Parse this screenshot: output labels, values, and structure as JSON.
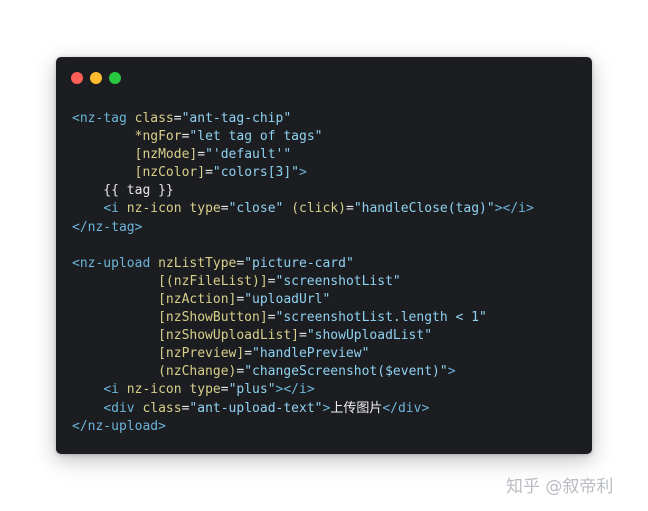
{
  "window": {
    "controls": [
      {
        "name": "close",
        "color": "#ff5f57"
      },
      {
        "name": "minimize",
        "color": "#febc2e"
      },
      {
        "name": "maximize",
        "color": "#28c840"
      }
    ]
  },
  "code_lines": [
    [
      {
        "t": "tag",
        "v": "<nz-tag "
      },
      {
        "t": "attr",
        "v": "class"
      },
      {
        "t": "punc",
        "v": "="
      },
      {
        "t": "str",
        "v": "\"ant-tag-chip\""
      }
    ],
    [
      {
        "t": "plain",
        "v": "        "
      },
      {
        "t": "attr",
        "v": "*ngFor"
      },
      {
        "t": "punc",
        "v": "="
      },
      {
        "t": "str",
        "v": "\"let tag of tags\""
      }
    ],
    [
      {
        "t": "plain",
        "v": "        "
      },
      {
        "t": "attr",
        "v": "[nzMode]"
      },
      {
        "t": "punc",
        "v": "="
      },
      {
        "t": "str",
        "v": "\"'default'\""
      }
    ],
    [
      {
        "t": "plain",
        "v": "        "
      },
      {
        "t": "attr",
        "v": "[nzColor]"
      },
      {
        "t": "punc",
        "v": "="
      },
      {
        "t": "str",
        "v": "\"colors[3]\""
      },
      {
        "t": "tag",
        "v": ">"
      }
    ],
    [
      {
        "t": "plain",
        "v": "    {{ tag }}"
      }
    ],
    [
      {
        "t": "plain",
        "v": "    "
      },
      {
        "t": "tag",
        "v": "<i "
      },
      {
        "t": "attr",
        "v": "nz-icon "
      },
      {
        "t": "attr",
        "v": "type"
      },
      {
        "t": "punc",
        "v": "="
      },
      {
        "t": "str",
        "v": "\"close\""
      },
      {
        "t": "plain",
        "v": " "
      },
      {
        "t": "attr",
        "v": "(click)"
      },
      {
        "t": "punc",
        "v": "="
      },
      {
        "t": "str",
        "v": "\"handleClose(tag)\""
      },
      {
        "t": "tag",
        "v": "></i>"
      }
    ],
    [
      {
        "t": "tag",
        "v": "</nz-tag>"
      }
    ],
    [
      {
        "t": "plain",
        "v": ""
      }
    ],
    [
      {
        "t": "tag",
        "v": "<nz-upload "
      },
      {
        "t": "attr",
        "v": "nzListType"
      },
      {
        "t": "punc",
        "v": "="
      },
      {
        "t": "str",
        "v": "\"picture-card\""
      }
    ],
    [
      {
        "t": "plain",
        "v": "           "
      },
      {
        "t": "attr",
        "v": "[(nzFileList)]"
      },
      {
        "t": "punc",
        "v": "="
      },
      {
        "t": "str",
        "v": "\"screenshotList\""
      }
    ],
    [
      {
        "t": "plain",
        "v": "           "
      },
      {
        "t": "attr",
        "v": "[nzAction]"
      },
      {
        "t": "punc",
        "v": "="
      },
      {
        "t": "str",
        "v": "\"uploadUrl\""
      }
    ],
    [
      {
        "t": "plain",
        "v": "           "
      },
      {
        "t": "attr",
        "v": "[nzShowButton]"
      },
      {
        "t": "punc",
        "v": "="
      },
      {
        "t": "str",
        "v": "\"screenshotList.length < 1\""
      }
    ],
    [
      {
        "t": "plain",
        "v": "           "
      },
      {
        "t": "attr",
        "v": "[nzShowUploadList]"
      },
      {
        "t": "punc",
        "v": "="
      },
      {
        "t": "str",
        "v": "\"showUploadList\""
      }
    ],
    [
      {
        "t": "plain",
        "v": "           "
      },
      {
        "t": "attr",
        "v": "[nzPreview]"
      },
      {
        "t": "punc",
        "v": "="
      },
      {
        "t": "str",
        "v": "\"handlePreview\""
      }
    ],
    [
      {
        "t": "plain",
        "v": "           "
      },
      {
        "t": "attr",
        "v": "(nzChange)"
      },
      {
        "t": "punc",
        "v": "="
      },
      {
        "t": "str",
        "v": "\"changeScreenshot($event)\""
      },
      {
        "t": "tag",
        "v": ">"
      }
    ],
    [
      {
        "t": "plain",
        "v": "    "
      },
      {
        "t": "tag",
        "v": "<i "
      },
      {
        "t": "attr",
        "v": "nz-icon "
      },
      {
        "t": "attr",
        "v": "type"
      },
      {
        "t": "punc",
        "v": "="
      },
      {
        "t": "str",
        "v": "\"plus\""
      },
      {
        "t": "tag",
        "v": "></i>"
      }
    ],
    [
      {
        "t": "plain",
        "v": "    "
      },
      {
        "t": "tag",
        "v": "<div "
      },
      {
        "t": "attr",
        "v": "class"
      },
      {
        "t": "punc",
        "v": "="
      },
      {
        "t": "str",
        "v": "\"ant-upload-text\""
      },
      {
        "t": "tag",
        "v": ">"
      },
      {
        "t": "text",
        "v": "上传图片"
      },
      {
        "t": "tag",
        "v": "</div>"
      }
    ],
    [
      {
        "t": "tag",
        "v": "</nz-upload>"
      }
    ]
  ],
  "watermark": "知乎 @叙帝利"
}
